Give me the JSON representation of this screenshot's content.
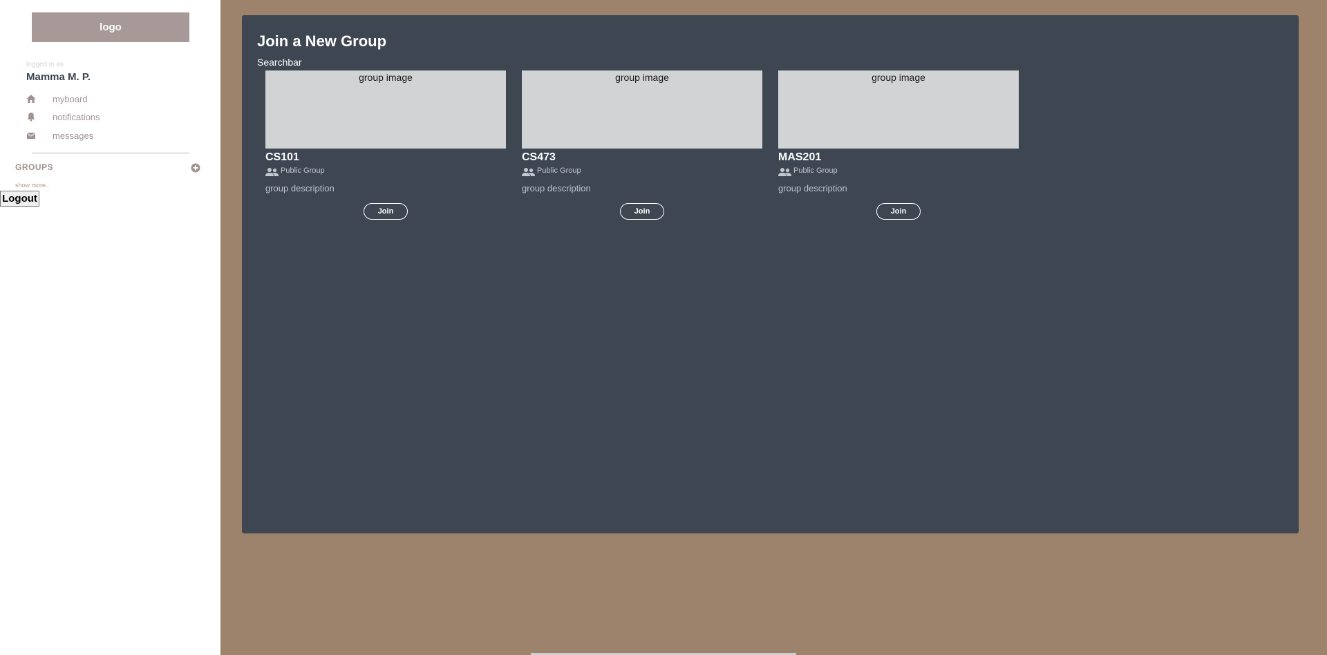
{
  "sidebar": {
    "logo_text": "logo",
    "logged_in_label": "logged in as",
    "user_name": "Mamma M. P.",
    "nav": [
      {
        "label": "myboard",
        "icon": "home-icon"
      },
      {
        "label": "notifications",
        "icon": "bell-icon"
      },
      {
        "label": "messages",
        "icon": "envelope-icon"
      }
    ],
    "groups_heading": "GROUPS",
    "add_group_icon": "plus-circle-icon",
    "show_more": "show more..",
    "logout_label": "Logout"
  },
  "main": {
    "title": "Join a New Group",
    "searchbar_text": "Searchbar",
    "groups": [
      {
        "image_label": "group image",
        "name": "CS101",
        "type": "Public Group",
        "description": "group description",
        "join_label": "Join"
      },
      {
        "image_label": "group image",
        "name": "CS473",
        "type": "Public Group",
        "description": "group description",
        "join_label": "Join"
      },
      {
        "image_label": "group image",
        "name": "MAS201",
        "type": "Public Group",
        "description": "group description",
        "join_label": "Join"
      }
    ]
  },
  "colors": {
    "background": "#9d826c",
    "panel": "#3d4651",
    "sidebar": "#ffffff",
    "logo_bg": "#a69997",
    "card_image": "#d2d3d5",
    "muted_text": "#a09291"
  }
}
